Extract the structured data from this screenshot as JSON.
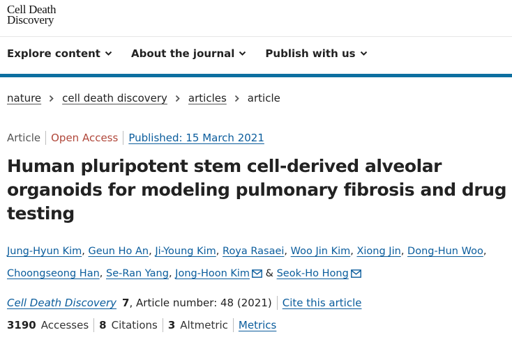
{
  "logo": {
    "line1": "Cell Death",
    "line2": "Discovery"
  },
  "nav": {
    "items": [
      {
        "label": "Explore content"
      },
      {
        "label": "About the journal"
      },
      {
        "label": "Publish with us"
      }
    ]
  },
  "breadcrumb": {
    "items": [
      "nature",
      "cell death discovery",
      "articles"
    ],
    "current": "article"
  },
  "meta": {
    "type": "Article",
    "access": "Open Access",
    "published": "Published: 15 March 2021"
  },
  "title": "Human pluripotent stem cell-derived alveolar organoids for modeling pulmonary fibrosis and drug testing",
  "authors": {
    "list": [
      "Jung-Hyun Kim",
      "Geun Ho An",
      "Ji-Young Kim",
      "Roya Rasaei",
      "Woo Jin Kim",
      "Xiong Jin",
      "Dong-Hun Woo",
      "Choongseong Han",
      "Se-Ran Yang",
      "Jong-Hoon Kim",
      "Seok-Ho Hong"
    ],
    "separator": ",",
    "conjunction": "&"
  },
  "citation": {
    "journal": "Cell Death Discovery",
    "volume": "7",
    "article_number": ", Article number: 48 (2021)",
    "cite_label": "Cite this article"
  },
  "metrics": {
    "accesses_count": "3190",
    "accesses_label": "Accesses",
    "citations_count": "8",
    "citations_label": "Citations",
    "altmetric_count": "3",
    "altmetric_label": "Altmetric",
    "metrics_link": "Metrics"
  },
  "icons": {
    "chevron": "chevron-down-icon",
    "crumb_separator": "chevron-right-icon",
    "mail": "envelope-icon"
  },
  "colors": {
    "brand_blue": "#0d6fa0",
    "link": "#0a5c9c",
    "open_access": "#b0473a"
  }
}
